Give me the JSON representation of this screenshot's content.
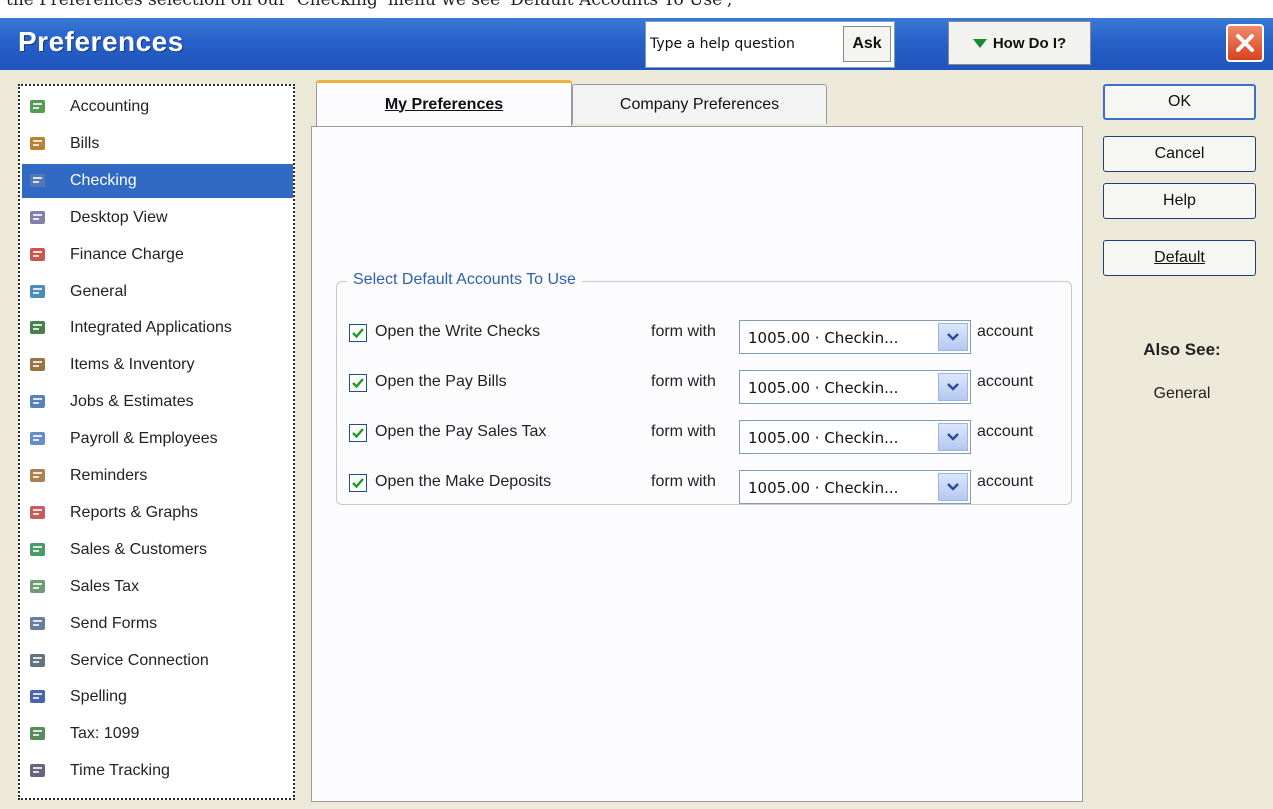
{
  "topstrip_text": "the Preferences selection on our 'Checking' menu we see 'Default Accounts To Use',",
  "window": {
    "title": "Preferences"
  },
  "help": {
    "placeholder": "Type a help question",
    "ask_label": "Ask",
    "how_do_i_label": "How Do I?"
  },
  "sidebar": {
    "selected": "Checking",
    "items": [
      {
        "label": "Accounting",
        "icon": "accounting-icon"
      },
      {
        "label": "Bills",
        "icon": "bills-icon"
      },
      {
        "label": "Checking",
        "icon": "checking-icon"
      },
      {
        "label": "Desktop View",
        "icon": "desktop-view-icon"
      },
      {
        "label": "Finance Charge",
        "icon": "finance-charge-icon"
      },
      {
        "label": "General",
        "icon": "general-icon"
      },
      {
        "label": "Integrated Applications",
        "icon": "integrated-applications-icon"
      },
      {
        "label": "Items & Inventory",
        "icon": "items-inventory-icon"
      },
      {
        "label": "Jobs & Estimates",
        "icon": "jobs-estimates-icon"
      },
      {
        "label": "Payroll & Employees",
        "icon": "payroll-employees-icon"
      },
      {
        "label": "Reminders",
        "icon": "reminders-icon"
      },
      {
        "label": "Reports & Graphs",
        "icon": "reports-graphs-icon"
      },
      {
        "label": "Sales & Customers",
        "icon": "sales-customers-icon"
      },
      {
        "label": "Sales Tax",
        "icon": "sales-tax-icon"
      },
      {
        "label": "Send Forms",
        "icon": "send-forms-icon"
      },
      {
        "label": "Service Connection",
        "icon": "service-connection-icon"
      },
      {
        "label": "Spelling",
        "icon": "spelling-icon"
      },
      {
        "label": "Tax: 1099",
        "icon": "tax-1099-icon"
      },
      {
        "label": "Time Tracking",
        "icon": "time-tracking-icon"
      }
    ]
  },
  "tabs": [
    {
      "label": "My Preferences",
      "active": true
    },
    {
      "label": "Company Preferences",
      "active": false
    }
  ],
  "group": {
    "title": "Select Default Accounts To Use",
    "form_with_label": "form with",
    "account_label": "account",
    "rows": [
      {
        "label": "Open the Write Checks",
        "checked": true,
        "account": "1005.00 · Checkin..."
      },
      {
        "label": "Open the Pay Bills",
        "checked": true,
        "account": "1005.00 · Checkin..."
      },
      {
        "label": "Open the Pay Sales Tax",
        "checked": true,
        "account": "1005.00 · Checkin..."
      },
      {
        "label": "Open the Make Deposits",
        "checked": true,
        "account": "1005.00 · Checkin..."
      }
    ]
  },
  "buttons": {
    "ok": "OK",
    "cancel": "Cancel",
    "help": "Help",
    "default": "Default"
  },
  "also_see": {
    "heading": "Also See:",
    "link": "General"
  },
  "colors": {
    "title_bar": "#2660c8",
    "selection": "#316ac5",
    "group_title": "#2f5fb0",
    "check": "#1a9a28"
  }
}
